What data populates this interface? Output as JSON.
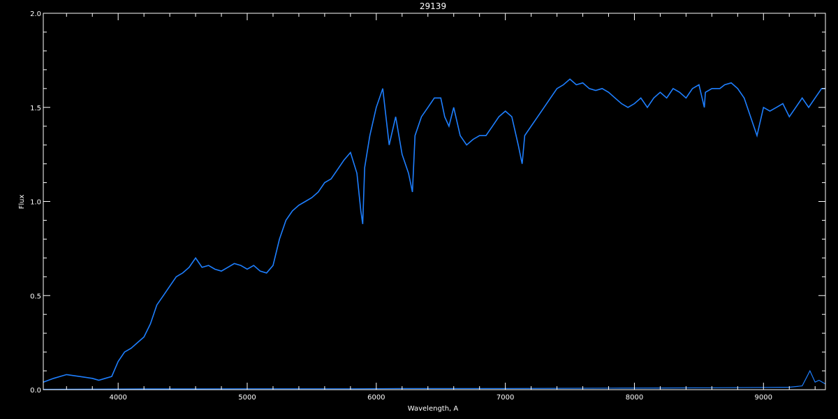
{
  "chart_data": {
    "type": "line",
    "title": "29139",
    "xlabel": "Wavelength, A",
    "ylabel": "Flux",
    "xlim": [
      3420,
      9480
    ],
    "ylim": [
      0.0,
      2.0
    ],
    "xticks": [
      4000,
      5000,
      6000,
      7000,
      8000,
      9000
    ],
    "yticks": [
      0.0,
      0.5,
      1.0,
      1.5,
      2.0
    ],
    "ytick_labels": [
      "0.0",
      "0.5",
      "1.0",
      "1.5",
      "2.0"
    ],
    "grid": false,
    "colors": {
      "background": "#000000",
      "axes": "#ffffff",
      "series": "#1e7fff"
    },
    "series": [
      {
        "x": [
          3420,
          3500,
          3600,
          3700,
          3800,
          3850,
          3900,
          3950,
          4000,
          4050,
          4100,
          4150,
          4200,
          4250,
          4300,
          4350,
          4400,
          4450,
          4500,
          4550,
          4600,
          4650,
          4700,
          4750,
          4800,
          4850,
          4900,
          4950,
          5000,
          5050,
          5100,
          5150,
          5200,
          5250,
          5300,
          5350,
          5400,
          5450,
          5500,
          5550,
          5600,
          5650,
          5700,
          5750,
          5800,
          5850,
          5880,
          5895,
          5910,
          5950,
          6000,
          6050,
          6100,
          6150,
          6200,
          6250,
          6280,
          6300,
          6350,
          6400,
          6450,
          6500,
          6530,
          6563,
          6600,
          6650,
          6700,
          6750,
          6800,
          6850,
          6900,
          6950,
          7000,
          7050,
          7100,
          7130,
          7150,
          7200,
          7250,
          7300,
          7350,
          7400,
          7450,
          7500,
          7550,
          7600,
          7650,
          7700,
          7750,
          7800,
          7850,
          7900,
          7950,
          8000,
          8050,
          8100,
          8150,
          8200,
          8250,
          8300,
          8350,
          8400,
          8450,
          8500,
          8542,
          8550,
          8600,
          8662,
          8700,
          8750,
          8800,
          8850,
          8900,
          8950,
          9000,
          9050,
          9100,
          9150,
          9200,
          9250,
          9300,
          9350,
          9400,
          9450,
          9480
        ],
        "y": [
          0.04,
          0.06,
          0.08,
          0.07,
          0.06,
          0.05,
          0.06,
          0.07,
          0.15,
          0.2,
          0.22,
          0.25,
          0.28,
          0.35,
          0.45,
          0.5,
          0.55,
          0.6,
          0.62,
          0.65,
          0.7,
          0.65,
          0.66,
          0.64,
          0.63,
          0.65,
          0.67,
          0.66,
          0.64,
          0.66,
          0.63,
          0.62,
          0.66,
          0.8,
          0.9,
          0.95,
          0.98,
          1.0,
          1.02,
          1.05,
          1.1,
          1.12,
          1.17,
          1.22,
          1.26,
          1.15,
          0.95,
          0.88,
          1.18,
          1.35,
          1.5,
          1.6,
          1.3,
          1.45,
          1.25,
          1.15,
          1.05,
          1.35,
          1.45,
          1.5,
          1.55,
          1.55,
          1.45,
          1.4,
          1.5,
          1.35,
          1.3,
          1.33,
          1.35,
          1.35,
          1.4,
          1.45,
          1.48,
          1.45,
          1.3,
          1.2,
          1.35,
          1.4,
          1.45,
          1.5,
          1.55,
          1.6,
          1.62,
          1.65,
          1.62,
          1.63,
          1.6,
          1.59,
          1.6,
          1.58,
          1.55,
          1.52,
          1.5,
          1.52,
          1.55,
          1.5,
          1.55,
          1.58,
          1.55,
          1.6,
          1.58,
          1.55,
          1.6,
          1.62,
          1.5,
          1.58,
          1.6,
          1.6,
          1.62,
          1.63,
          1.6,
          1.55,
          1.45,
          1.35,
          1.5,
          1.48,
          1.5,
          1.52,
          1.45,
          1.5,
          1.55,
          1.5,
          1.55,
          1.6,
          1.6
        ]
      },
      {
        "x": [
          3420,
          3800,
          4200,
          4600,
          5000,
          5400,
          5800,
          6200,
          6600,
          7000,
          7400,
          7800,
          8200,
          8600,
          9000,
          9200,
          9300,
          9330,
          9360,
          9400,
          9430,
          9480
        ],
        "y": [
          0.002,
          0.003,
          0.004,
          0.004,
          0.005,
          0.005,
          0.005,
          0.006,
          0.006,
          0.006,
          0.007,
          0.008,
          0.009,
          0.01,
          0.012,
          0.013,
          0.02,
          0.06,
          0.1,
          0.04,
          0.05,
          0.03
        ]
      }
    ]
  }
}
